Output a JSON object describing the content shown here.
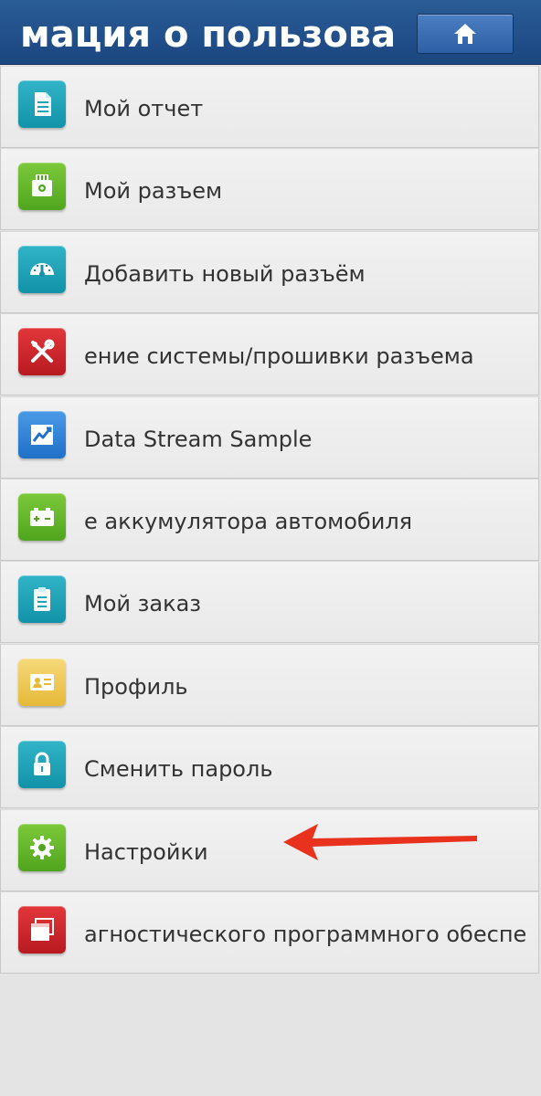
{
  "header": {
    "title": "мация о пользова",
    "home_icon": "home-icon"
  },
  "menu": [
    {
      "label": "Мой отчет",
      "icon": "report-icon",
      "color": "#1fa3b8"
    },
    {
      "label": "Мой разъем",
      "icon": "connector-icon",
      "color": "#62b52a"
    },
    {
      "label": "Добавить новый разъём",
      "icon": "gauge-icon",
      "color": "#1fa3b8"
    },
    {
      "label": "ение системы/прошивки разъема",
      "icon": "tools-icon",
      "color": "#cc262b"
    },
    {
      "label": "Data Stream Sample",
      "icon": "chart-icon",
      "color": "#2f82d6"
    },
    {
      "label": "е аккумулятора автомобиля",
      "icon": "battery-icon",
      "color": "#62b52a"
    },
    {
      "label": "Мой заказ",
      "icon": "clipboard-icon",
      "color": "#1fa3b8"
    },
    {
      "label": "Профиль",
      "icon": "id-card-icon",
      "color": "#eec95a"
    },
    {
      "label": "Сменить пароль",
      "icon": "lock-icon",
      "color": "#1fa3b8"
    },
    {
      "label": "Настройки",
      "icon": "gear-icon",
      "color": "#62b52a"
    },
    {
      "label": "агностического программного обеспе",
      "icon": "window-icon",
      "color": "#cc262b"
    }
  ],
  "annotation": {
    "icon": "red-arrow-icon",
    "color": "#e8321e"
  }
}
